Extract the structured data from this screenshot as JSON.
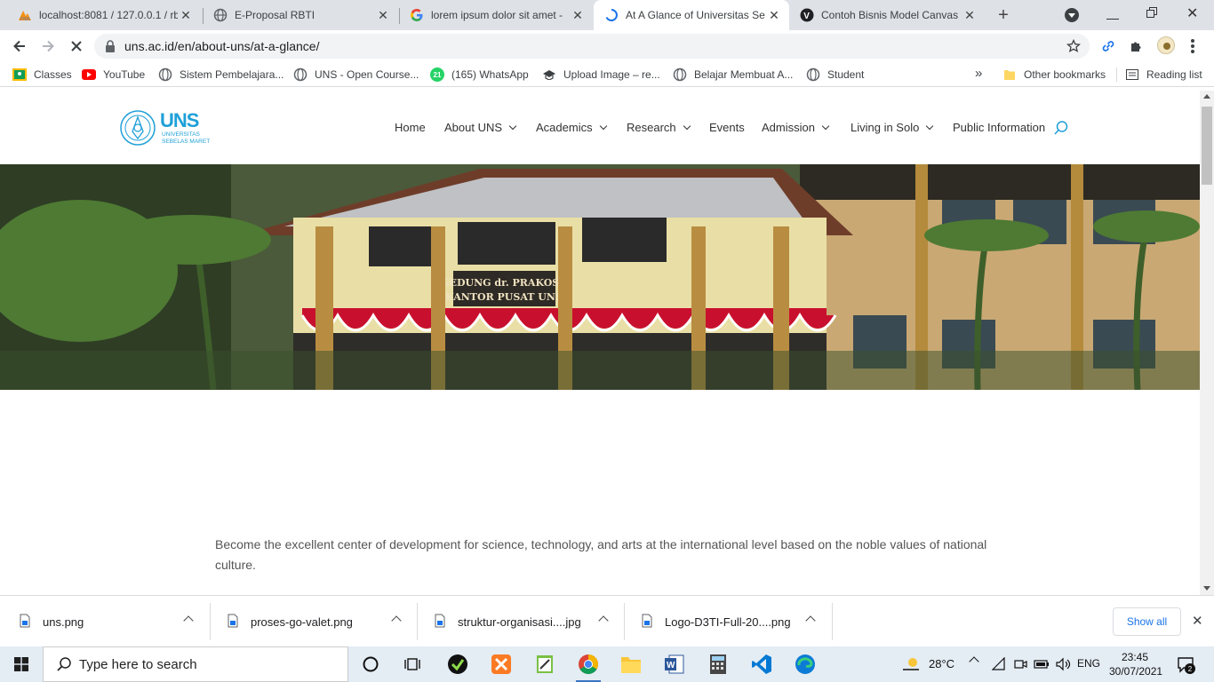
{
  "tabs": [
    {
      "title": "localhost:8081 / 127.0.0.1 / rb",
      "icon": "phpmyadmin-icon",
      "active": false
    },
    {
      "title": "E-Proposal RBTI",
      "icon": "globe-icon",
      "active": false
    },
    {
      "title": "lorem ipsum dolor sit amet -",
      "icon": "google-icon",
      "active": false
    },
    {
      "title": "At A Glance of Universitas Se",
      "icon": "loading-spinner-icon",
      "active": true
    },
    {
      "title": "Contoh Bisnis Model Canvas",
      "icon": "v-icon",
      "active": false
    }
  ],
  "toolbar": {
    "url": "uns.ac.id/en/about-uns/at-a-glance/"
  },
  "bookmarks": {
    "items": [
      {
        "label": "Classes",
        "icon": "classroom-icon"
      },
      {
        "label": "YouTube",
        "icon": "youtube-icon"
      },
      {
        "label": "Sistem Pembelajara...",
        "icon": "globe-icon"
      },
      {
        "label": "UNS - Open Course...",
        "icon": "globe-icon"
      },
      {
        "label": "(165) WhatsApp",
        "icon": "whatsapp-icon",
        "badge": "21"
      },
      {
        "label": "Upload Image – re...",
        "icon": "upload-icon"
      },
      {
        "label": "Belajar Membuat A...",
        "icon": "globe-icon"
      },
      {
        "label": "Student",
        "icon": "globe-icon"
      }
    ],
    "overflow": "»",
    "other": "Other bookmarks",
    "reading_list": "Reading list"
  },
  "site": {
    "logo": {
      "abbr": "UNS",
      "line1": "UNIVERSITAS",
      "line2": "SEBELAS MARET"
    },
    "nav": [
      {
        "label": "Home",
        "dropdown": false
      },
      {
        "label": "About UNS",
        "dropdown": true
      },
      {
        "label": "Academics",
        "dropdown": true
      },
      {
        "label": "Research",
        "dropdown": true
      },
      {
        "label": "Events",
        "dropdown": false
      },
      {
        "label": "Admission",
        "dropdown": true
      },
      {
        "label": "Living in Solo",
        "dropdown": true
      },
      {
        "label": "Public Information",
        "dropdown": false
      }
    ],
    "hero_sign_line1": "GEDUNG dr. PRAKOSA",
    "hero_sign_line2": "KANTOR PUSAT UNS",
    "mission": "Become the excellent center of development for science, technology, and arts at the international level based on the noble values of national culture."
  },
  "downloads": {
    "files": [
      {
        "name": "uns.png"
      },
      {
        "name": "proses-go-valet.png"
      },
      {
        "name": "struktur-organisasi....jpg"
      },
      {
        "name": "Logo-D3TI-Full-20....png"
      }
    ],
    "show_all": "Show all"
  },
  "taskbar": {
    "search_placeholder": "Type here to search",
    "weather": "28°C",
    "language": "ENG",
    "time": "23:45",
    "date": "30/07/2021",
    "notification_count": "2"
  },
  "colors": {
    "uns_blue": "#1fa0d8",
    "tab_strip": "#dee1e6",
    "taskbar": "#e4ecf4"
  }
}
